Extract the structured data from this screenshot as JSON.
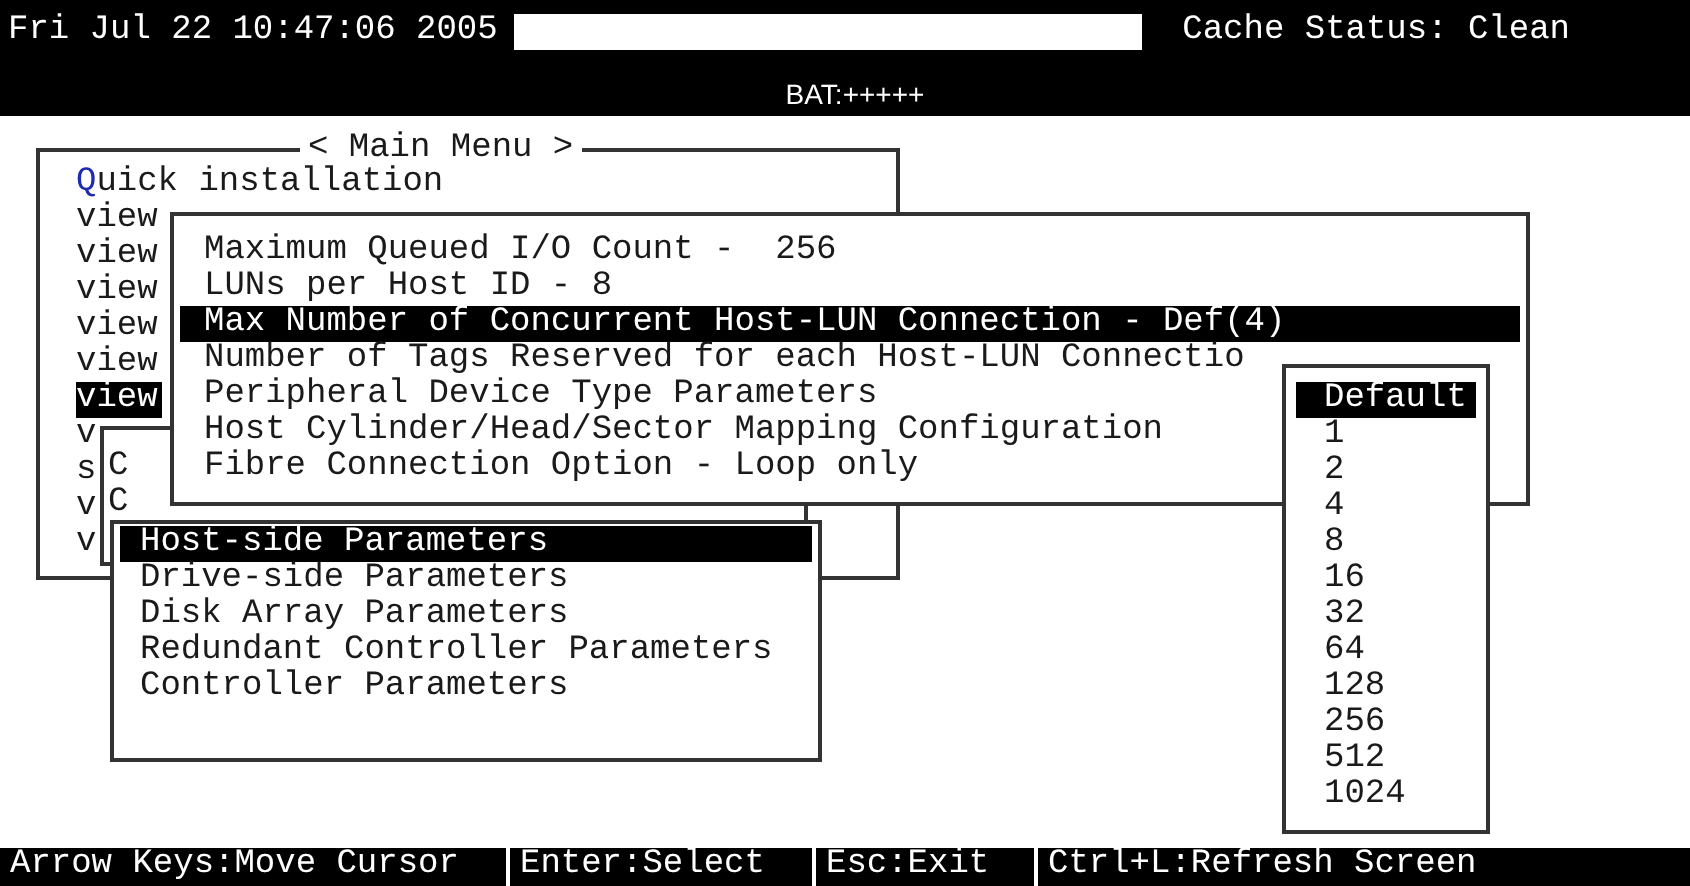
{
  "top_bar": {
    "datetime": "Fri Jul 22 10:47:06 2005",
    "cache_status": "Cache Status: Clean",
    "battery": "BAT:+++++"
  },
  "main_menu": {
    "title": "< Main Menu >",
    "items": [
      {
        "hotkey": "Q",
        "label": "uick installation",
        "selected": false
      },
      {
        "label": "view",
        "selected": false
      },
      {
        "label": "view",
        "selected": false
      },
      {
        "label": "view",
        "selected": false
      },
      {
        "label": "view",
        "selected": false
      },
      {
        "label": "view",
        "selected": false
      },
      {
        "label": "view",
        "selected": true
      },
      {
        "label": "v",
        "selected": false
      },
      {
        "label": "s",
        "selected": false
      },
      {
        "label": "v",
        "selected": false
      },
      {
        "label": "v",
        "selected": false
      }
    ]
  },
  "config_menu": {
    "items": [
      {
        "label": "C",
        "selected": false
      },
      {
        "label": "C",
        "selected": false
      }
    ]
  },
  "parameters_menu": {
    "items": [
      {
        "label": "Host-side Parameters",
        "selected": true
      },
      {
        "label": "Drive-side Parameters",
        "selected": false
      },
      {
        "label": "Disk Array Parameters",
        "selected": false
      },
      {
        "label": "Redundant Controller Parameters",
        "selected": false
      },
      {
        "label": "Controller Parameters",
        "selected": false
      }
    ]
  },
  "host_parameters": {
    "items": [
      {
        "label": "Maximum Queued I/O Count -  256",
        "selected": false
      },
      {
        "label": "LUNs per Host ID - 8",
        "selected": false
      },
      {
        "label": "Max Number of Concurrent Host-LUN Connection - Def(4)",
        "selected": true
      },
      {
        "label": "Number of Tags Reserved for each Host-LUN Connectio",
        "selected": false
      },
      {
        "label": "Peripheral Device Type Parameters",
        "selected": false
      },
      {
        "label": "Host Cylinder/Head/Sector Mapping Configuration",
        "selected": false
      },
      {
        "label": "Fibre Connection Option - Loop only",
        "selected": false
      }
    ]
  },
  "option_list": {
    "items": [
      {
        "label": "Default",
        "selected": true
      },
      {
        "label": "1",
        "selected": false
      },
      {
        "label": "2",
        "selected": false
      },
      {
        "label": "4",
        "selected": false
      },
      {
        "label": "8",
        "selected": false
      },
      {
        "label": "16",
        "selected": false
      },
      {
        "label": "32",
        "selected": false
      },
      {
        "label": "64",
        "selected": false
      },
      {
        "label": "128",
        "selected": false
      },
      {
        "label": "256",
        "selected": false
      },
      {
        "label": "512",
        "selected": false
      },
      {
        "label": "1024",
        "selected": false
      }
    ]
  },
  "status_bar": {
    "items": [
      "Arrow Keys:Move Cursor",
      "Enter:Select",
      "Esc:Exit",
      "Ctrl+L:Refresh Screen"
    ]
  }
}
